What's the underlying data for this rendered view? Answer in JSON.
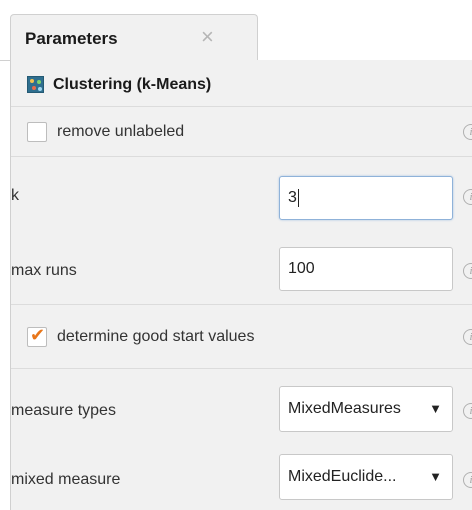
{
  "panel": {
    "tab_title": "Parameters",
    "tab_close_symbol": "×",
    "operator_name": "Clustering (k-Means)",
    "operator_icon": "clustering-icon"
  },
  "params": {
    "remove_unlabeled": {
      "label": "remove unlabeled",
      "checked": false
    },
    "k": {
      "label": "k",
      "value": "3"
    },
    "max_runs": {
      "label": "max runs",
      "value": "100"
    },
    "good_start": {
      "label": "determine good start values",
      "checked": true,
      "checkmark": "✔"
    },
    "measure_types": {
      "label": "measure types",
      "value": "MixedMeasures",
      "arrow": "▼"
    },
    "mixed_measure": {
      "label": "mixed measure",
      "value": "MixedEuclide...",
      "arrow": "▼"
    }
  },
  "info_icon": {
    "glyph": "i",
    "name": "info-icon"
  },
  "colors": {
    "panel_bg": "#f1f1f1",
    "check_accent": "#e8761a",
    "focus_border": "#8fb2d9"
  }
}
